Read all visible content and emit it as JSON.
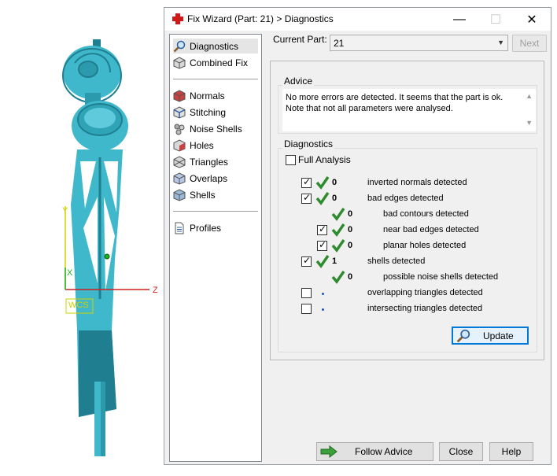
{
  "viewport": {
    "axis_labels": {
      "x": "X",
      "y": "Y",
      "z": "Z"
    },
    "wcs_label": "WCS"
  },
  "window": {
    "title": "Fix Wizard (Part: 21) > Diagnostics",
    "controls": {
      "minimize": "—",
      "maximize": "☐",
      "close": "✕"
    }
  },
  "sidebar": {
    "top_items": [
      {
        "label": "Diagnostics",
        "icon": "magnifier-icon",
        "selected": true
      },
      {
        "label": "Combined Fix",
        "icon": "cube-icon"
      }
    ],
    "fix_items": [
      {
        "label": "Normals",
        "icon": "normals-cube-icon"
      },
      {
        "label": "Stitching",
        "icon": "stitching-cube-icon"
      },
      {
        "label": "Noise Shells",
        "icon": "noise-shells-icon"
      },
      {
        "label": "Holes",
        "icon": "holes-cube-icon"
      },
      {
        "label": "Triangles",
        "icon": "triangles-cube-icon"
      },
      {
        "label": "Overlaps",
        "icon": "overlaps-cube-icon"
      },
      {
        "label": "Shells",
        "icon": "shells-cube-icon"
      }
    ],
    "bottom_items": [
      {
        "label": "Profiles",
        "icon": "document-icon"
      }
    ]
  },
  "current_part": {
    "label": "Current Part:",
    "value": "21",
    "next_label": "Next"
  },
  "advice": {
    "title": "Advice",
    "text": "No more errors are detected. It seems that the part is ok.\nNote that not all parameters were analysed."
  },
  "diagnostics": {
    "title": "Diagnostics",
    "full_analysis_label": "Full Analysis",
    "full_analysis_checked": false,
    "rows": [
      {
        "checkbox": true,
        "checked": true,
        "status": "ok",
        "count": "0",
        "label": "inverted normals detected",
        "indent": 0
      },
      {
        "checkbox": true,
        "checked": true,
        "status": "ok",
        "count": "0",
        "label": "bad edges detected",
        "indent": 0
      },
      {
        "checkbox": false,
        "checked": false,
        "status": "ok",
        "count": "0",
        "label": "bad contours detected",
        "indent": 1
      },
      {
        "checkbox": true,
        "checked": true,
        "status": "ok",
        "count": "0",
        "label": "near bad edges detected",
        "indent": 1
      },
      {
        "checkbox": true,
        "checked": true,
        "status": "ok",
        "count": "0",
        "label": "planar holes detected",
        "indent": 1
      },
      {
        "checkbox": true,
        "checked": true,
        "status": "ok",
        "count": "1",
        "label": "shells detected",
        "indent": 0
      },
      {
        "checkbox": false,
        "checked": false,
        "status": "ok",
        "count": "0",
        "label": "possible noise shells detected",
        "indent": 1
      },
      {
        "checkbox": true,
        "checked": false,
        "status": "pending",
        "count": "",
        "label": "overlapping triangles detected",
        "indent": 0
      },
      {
        "checkbox": true,
        "checked": false,
        "status": "pending",
        "count": "",
        "label": "intersecting triangles detected",
        "indent": 0
      }
    ],
    "update_label": "Update"
  },
  "footer": {
    "follow_advice_label": "Follow Advice",
    "close_label": "Close",
    "help_label": "Help"
  },
  "colors": {
    "model": "#3fb8cc",
    "model_dark": "#1f7f90",
    "ok_check": "#2e8b2e",
    "accent_blue": "#0078d7",
    "axis_x": "#d0d000",
    "axis_z": "#d02020",
    "axis_y": "#20b020"
  }
}
